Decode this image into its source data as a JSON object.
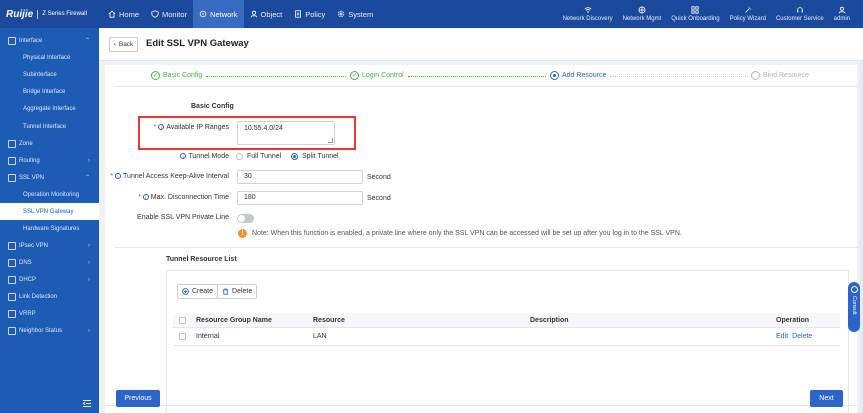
{
  "brand": {
    "logo": "Ruijie",
    "product": "Z Series Firewall"
  },
  "nav": [
    {
      "label": "Home",
      "icon": "home-icon"
    },
    {
      "label": "Monitor",
      "icon": "shield-icon"
    },
    {
      "label": "Network",
      "icon": "network-icon",
      "active": true
    },
    {
      "label": "Object",
      "icon": "user-icon"
    },
    {
      "label": "Policy",
      "icon": "doc-icon"
    },
    {
      "label": "System",
      "icon": "gear-icon"
    }
  ],
  "tools": [
    {
      "label": "Network Discovery",
      "icon": "wifi-icon"
    },
    {
      "label": "Network Mgmt",
      "icon": "globe-icon"
    },
    {
      "label": "Quick Onboarding",
      "icon": "grid-icon"
    },
    {
      "label": "Policy Wizard",
      "icon": "magic-icon"
    },
    {
      "label": "Customer Service",
      "icon": "headset-icon"
    },
    {
      "label": "admin",
      "icon": "person-icon"
    }
  ],
  "sidebar": {
    "items": [
      {
        "label": "Interface",
        "expandable": true,
        "expanded": true
      },
      {
        "label": "Physical Interface",
        "sub": true
      },
      {
        "label": "Subinterface",
        "sub": true
      },
      {
        "label": "Bridge Interface",
        "sub": true
      },
      {
        "label": "Aggregate Interface",
        "sub": true
      },
      {
        "label": "Tunnel Interface",
        "sub": true
      },
      {
        "label": "Zone"
      },
      {
        "label": "Routing",
        "expandable": true
      },
      {
        "label": "SSL VPN",
        "expandable": true,
        "expanded": true
      },
      {
        "label": "Operation Monitoring",
        "sub": true
      },
      {
        "label": "SSL VPN Gateway",
        "sub": true,
        "selected": true
      },
      {
        "label": "Hardware Signatures",
        "sub": true
      },
      {
        "label": "IPsec VPN",
        "expandable": true
      },
      {
        "label": "DNS",
        "expandable": true
      },
      {
        "label": "DHCP",
        "expandable": true
      },
      {
        "label": "Link Detection"
      },
      {
        "label": "VRRP"
      },
      {
        "label": "Neighbor Status",
        "expandable": true
      }
    ]
  },
  "header": {
    "back_label": "Back",
    "title": "Edit SSL VPN Gateway"
  },
  "steps": [
    {
      "label": "Basic Config",
      "state": "done"
    },
    {
      "label": "Login Control",
      "state": "done"
    },
    {
      "label": "Add Resource",
      "state": "current"
    },
    {
      "label": "Bind Resource",
      "state": "pending"
    }
  ],
  "form": {
    "section_title": "Basic Config",
    "ip_ranges_label": "Available IP Ranges",
    "ip_ranges_value": "10.55.4.0/24",
    "tunnel_mode_label": "Tunnel Mode",
    "tunnel_mode_options": [
      "Full Tunnel",
      "Split Tunnel"
    ],
    "tunnel_mode_selected": "Split Tunnel",
    "keepalive_label": "Tunnel Access Keep-Alive Interval",
    "keepalive_value": "30",
    "keepalive_unit": "Second",
    "disconnect_label": "Max. Disconnection Time",
    "disconnect_value": "180",
    "disconnect_unit": "Second",
    "private_line_label": "Enable SSL VPN Private Line",
    "private_line_enabled": false,
    "note": "Note: When this function is enabled, a private line where only the SSL VPN can be accessed will be set up after you log in to the SSL VPN."
  },
  "tunnel_resources": {
    "title": "Tunnel Resource List",
    "create_label": "Create",
    "delete_label": "Delete",
    "columns": [
      "Resource Group Name",
      "Resource",
      "Description",
      "Operation"
    ],
    "rows": [
      {
        "name": "Internal",
        "resource": "LAN",
        "description": "",
        "edit": "Edit",
        "delete": "Delete"
      }
    ]
  },
  "footer": {
    "previous_label": "Previous",
    "next_label": "Next"
  },
  "consult": {
    "label": "Consult"
  },
  "colors": {
    "topbar": "#1b4a9c",
    "sidebar": "#1d5cb4",
    "accent": "#2d64c8",
    "done": "#49b24a",
    "highlight": "#e53935"
  }
}
